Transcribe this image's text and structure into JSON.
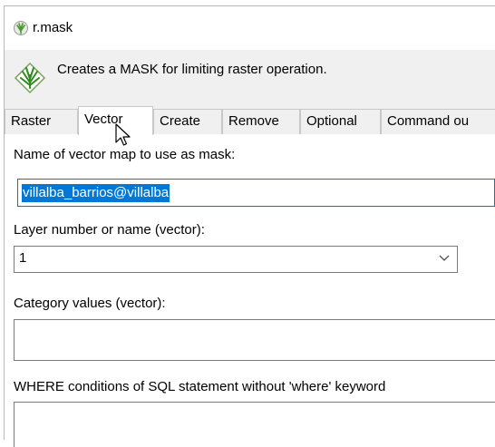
{
  "window": {
    "title": "r.mask",
    "description": "Creates a MASK for limiting raster operation."
  },
  "tabs": [
    {
      "label": "Raster"
    },
    {
      "label": "Vector"
    },
    {
      "label": "Create"
    },
    {
      "label": "Remove"
    },
    {
      "label": "Optional"
    },
    {
      "label": "Command ou"
    }
  ],
  "fields": {
    "vector_map": {
      "label": "Name of vector map to use as mask:",
      "value": "villalba_barrios@villalba"
    },
    "layer": {
      "label": "Layer number or name (vector):",
      "value": "1"
    },
    "category": {
      "label": "Category values (vector):",
      "value": ""
    },
    "where": {
      "label": "WHERE conditions of SQL statement without 'where' keyword",
      "value": ""
    }
  },
  "colors": {
    "selection": "#0078d7",
    "header_bg": "#f0f0f0"
  }
}
